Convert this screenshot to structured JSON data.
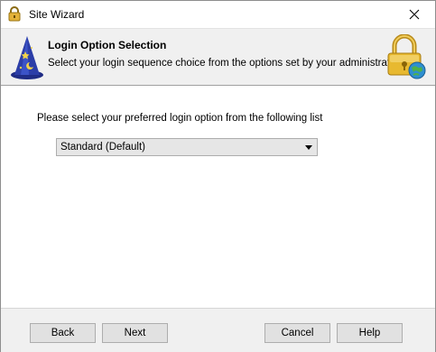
{
  "window": {
    "title": "Site Wizard"
  },
  "header": {
    "title": "Login Option Selection",
    "subtitle": "Select your login sequence choice from the options set by your administrator",
    "left_icon": "wizard-hat-icon",
    "right_icon": "lock-globe-icon"
  },
  "main": {
    "prompt": "Please select your preferred  login option from the following list",
    "login_option": {
      "selected": "Standard  (Default)"
    }
  },
  "footer": {
    "back_label": "Back",
    "next_label": "Next",
    "cancel_label": "Cancel",
    "help_label": "Help"
  },
  "colors": {
    "header_bg": "#f0f0f0",
    "footer_bg": "#f0f0f0",
    "button_bg": "#e1e1e1",
    "lock_gold": "#e0b22e",
    "wizard_blue": "#2a3a9a"
  }
}
